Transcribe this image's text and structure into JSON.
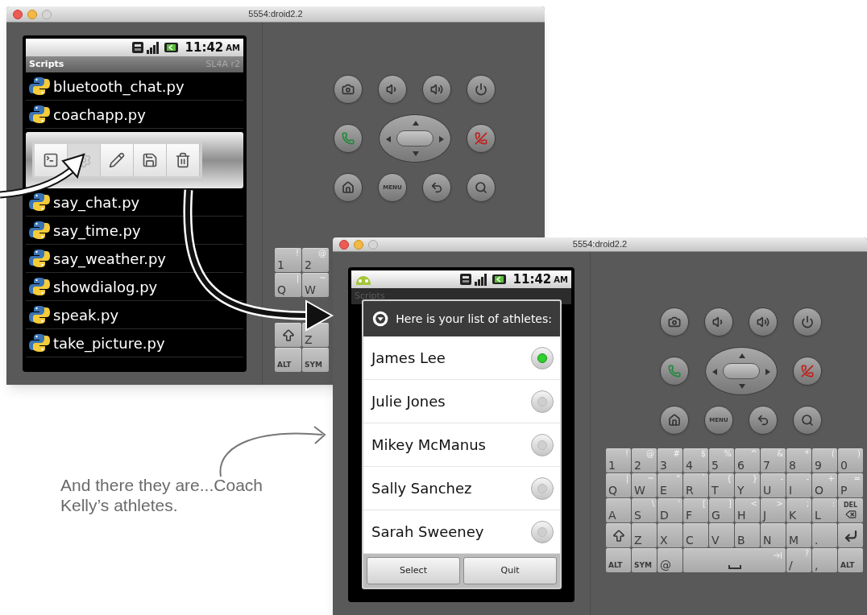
{
  "back_emulator": {
    "title": "5554:droid2.2",
    "status_time": "11:42",
    "status_period": "AM",
    "app_bar": {
      "title": "Scripts",
      "subtitle": "SL4A r2"
    },
    "scripts_before": [
      {
        "name": "bluetooth_chat.py"
      },
      {
        "name": "coachapp.py"
      }
    ],
    "context_toolbar": [
      {
        "kind": "terminal",
        "disabled": false
      },
      {
        "kind": "gear",
        "disabled": true
      },
      {
        "kind": "pencil",
        "disabled": false
      },
      {
        "kind": "save",
        "disabled": false
      },
      {
        "kind": "trash",
        "disabled": false
      }
    ],
    "scripts_after": [
      {
        "name": "say_chat.py"
      },
      {
        "name": "say_time.py"
      },
      {
        "name": "say_weather.py"
      },
      {
        "name": "showdialog.py"
      },
      {
        "name": "speak.py"
      },
      {
        "name": "take_picture.py"
      }
    ],
    "hardware_buttons": [
      [
        {
          "kind": "camera"
        },
        {
          "kind": "volume_down"
        },
        {
          "kind": "volume_up"
        },
        {
          "kind": "power"
        }
      ],
      [
        {
          "kind": "call"
        },
        {
          "kind": "dpad"
        },
        {
          "kind": "end_call"
        }
      ],
      [
        {
          "kind": "home"
        },
        {
          "kind": "menu",
          "label": "MENU"
        },
        {
          "kind": "back"
        },
        {
          "kind": "search"
        }
      ]
    ],
    "keyboard": [
      [
        {
          "kind": "char",
          "label": "1",
          "symbol": "!"
        },
        {
          "kind": "char",
          "label": "2",
          "symbol": "@"
        }
      ],
      [
        {
          "kind": "char",
          "label": "Q",
          "symbol": "|"
        },
        {
          "kind": "char",
          "label": "W",
          "symbol": "~"
        }
      ],
      [
        {
          "kind": "shift"
        },
        {
          "kind": "char",
          "label": "Z"
        }
      ],
      [
        {
          "kind": "char",
          "label": "ALT"
        },
        {
          "kind": "char",
          "label": "SYM"
        }
      ]
    ]
  },
  "front_emulator": {
    "title": "5554:droid2.2",
    "status_time": "11:42",
    "status_period": "AM",
    "app_bar_title": "Scripts",
    "dialog": {
      "title": "Here is your list of athletes:",
      "athletes": [
        {
          "name": "James Lee",
          "selected": true
        },
        {
          "name": "Julie Jones",
          "selected": false
        },
        {
          "name": "Mikey McManus",
          "selected": false
        },
        {
          "name": "Sally Sanchez",
          "selected": false
        },
        {
          "name": "Sarah Sweeney",
          "selected": false
        }
      ],
      "buttons": [
        "Select",
        "Quit"
      ]
    },
    "hardware_buttons": [
      [
        {
          "kind": "camera"
        },
        {
          "kind": "volume_down"
        },
        {
          "kind": "volume_up"
        },
        {
          "kind": "power"
        }
      ],
      [
        {
          "kind": "call"
        },
        {
          "kind": "dpad"
        },
        {
          "kind": "end_call"
        }
      ],
      [
        {
          "kind": "home"
        },
        {
          "kind": "menu",
          "label": "MENU"
        },
        {
          "kind": "back"
        },
        {
          "kind": "search"
        }
      ]
    ],
    "keyboard": [
      [
        {
          "kind": "char",
          "label": "1",
          "symbol": "!"
        },
        {
          "kind": "char",
          "label": "2",
          "symbol": "@"
        },
        {
          "kind": "char",
          "label": "3",
          "symbol": "#"
        },
        {
          "kind": "char",
          "label": "4",
          "symbol": "$"
        },
        {
          "kind": "char",
          "label": "5",
          "symbol": "%"
        },
        {
          "kind": "char",
          "label": "6",
          "symbol": "^"
        },
        {
          "kind": "char",
          "label": "7",
          "symbol": "&"
        },
        {
          "kind": "char",
          "label": "8",
          "symbol": "*"
        },
        {
          "kind": "char",
          "label": "9",
          "symbol": "("
        },
        {
          "kind": "char",
          "label": "0",
          "symbol": ")"
        }
      ],
      [
        {
          "kind": "char",
          "label": "Q",
          "symbol": "|"
        },
        {
          "kind": "char",
          "label": "W",
          "symbol": "~"
        },
        {
          "kind": "char",
          "label": "E",
          "symbol": "\""
        },
        {
          "kind": "char",
          "label": "R",
          "symbol": "`"
        },
        {
          "kind": "char",
          "label": "T",
          "symbol": "{"
        },
        {
          "kind": "char",
          "label": "Y",
          "symbol": "}"
        },
        {
          "kind": "char",
          "label": "U",
          "symbol": "-"
        },
        {
          "kind": "char",
          "label": "I",
          "symbol": "-"
        },
        {
          "kind": "char",
          "label": "O",
          "symbol": "+"
        },
        {
          "kind": "char",
          "label": "P",
          "symbol": "="
        }
      ],
      [
        {
          "kind": "char",
          "label": "A"
        },
        {
          "kind": "char",
          "label": "S",
          "symbol": "\\"
        },
        {
          "kind": "char",
          "label": "D",
          "symbol": "'"
        },
        {
          "kind": "char",
          "label": "F",
          "symbol": "["
        },
        {
          "kind": "char",
          "label": "G",
          "symbol": "]"
        },
        {
          "kind": "char",
          "label": "H",
          "symbol": "<"
        },
        {
          "kind": "char",
          "label": "J",
          "symbol": ">"
        },
        {
          "kind": "char",
          "label": "K",
          "symbol": ";"
        },
        {
          "kind": "char",
          "label": "L",
          "symbol": ":"
        },
        {
          "kind": "delete",
          "label": "DEL"
        }
      ],
      [
        {
          "kind": "shift"
        },
        {
          "kind": "char",
          "label": "Z"
        },
        {
          "kind": "char",
          "label": "X"
        },
        {
          "kind": "char",
          "label": "C"
        },
        {
          "kind": "char",
          "label": "V"
        },
        {
          "kind": "char",
          "label": "B"
        },
        {
          "kind": "char",
          "label": "N"
        },
        {
          "kind": "char",
          "label": "M"
        },
        {
          "kind": "char",
          "label": "."
        },
        {
          "kind": "enter"
        }
      ],
      [
        {
          "kind": "char",
          "label": "ALT"
        },
        {
          "kind": "char",
          "label": "SYM"
        },
        {
          "kind": "char",
          "label": "@"
        },
        {
          "kind": "space"
        },
        {
          "kind": "char",
          "label": "/",
          "symbol": "?"
        },
        {
          "kind": "char",
          "label": ","
        },
        {
          "kind": "char",
          "label": "ALT"
        }
      ]
    ]
  },
  "annotation": {
    "text": "And there they are...Coach Kelly’s athletes."
  }
}
